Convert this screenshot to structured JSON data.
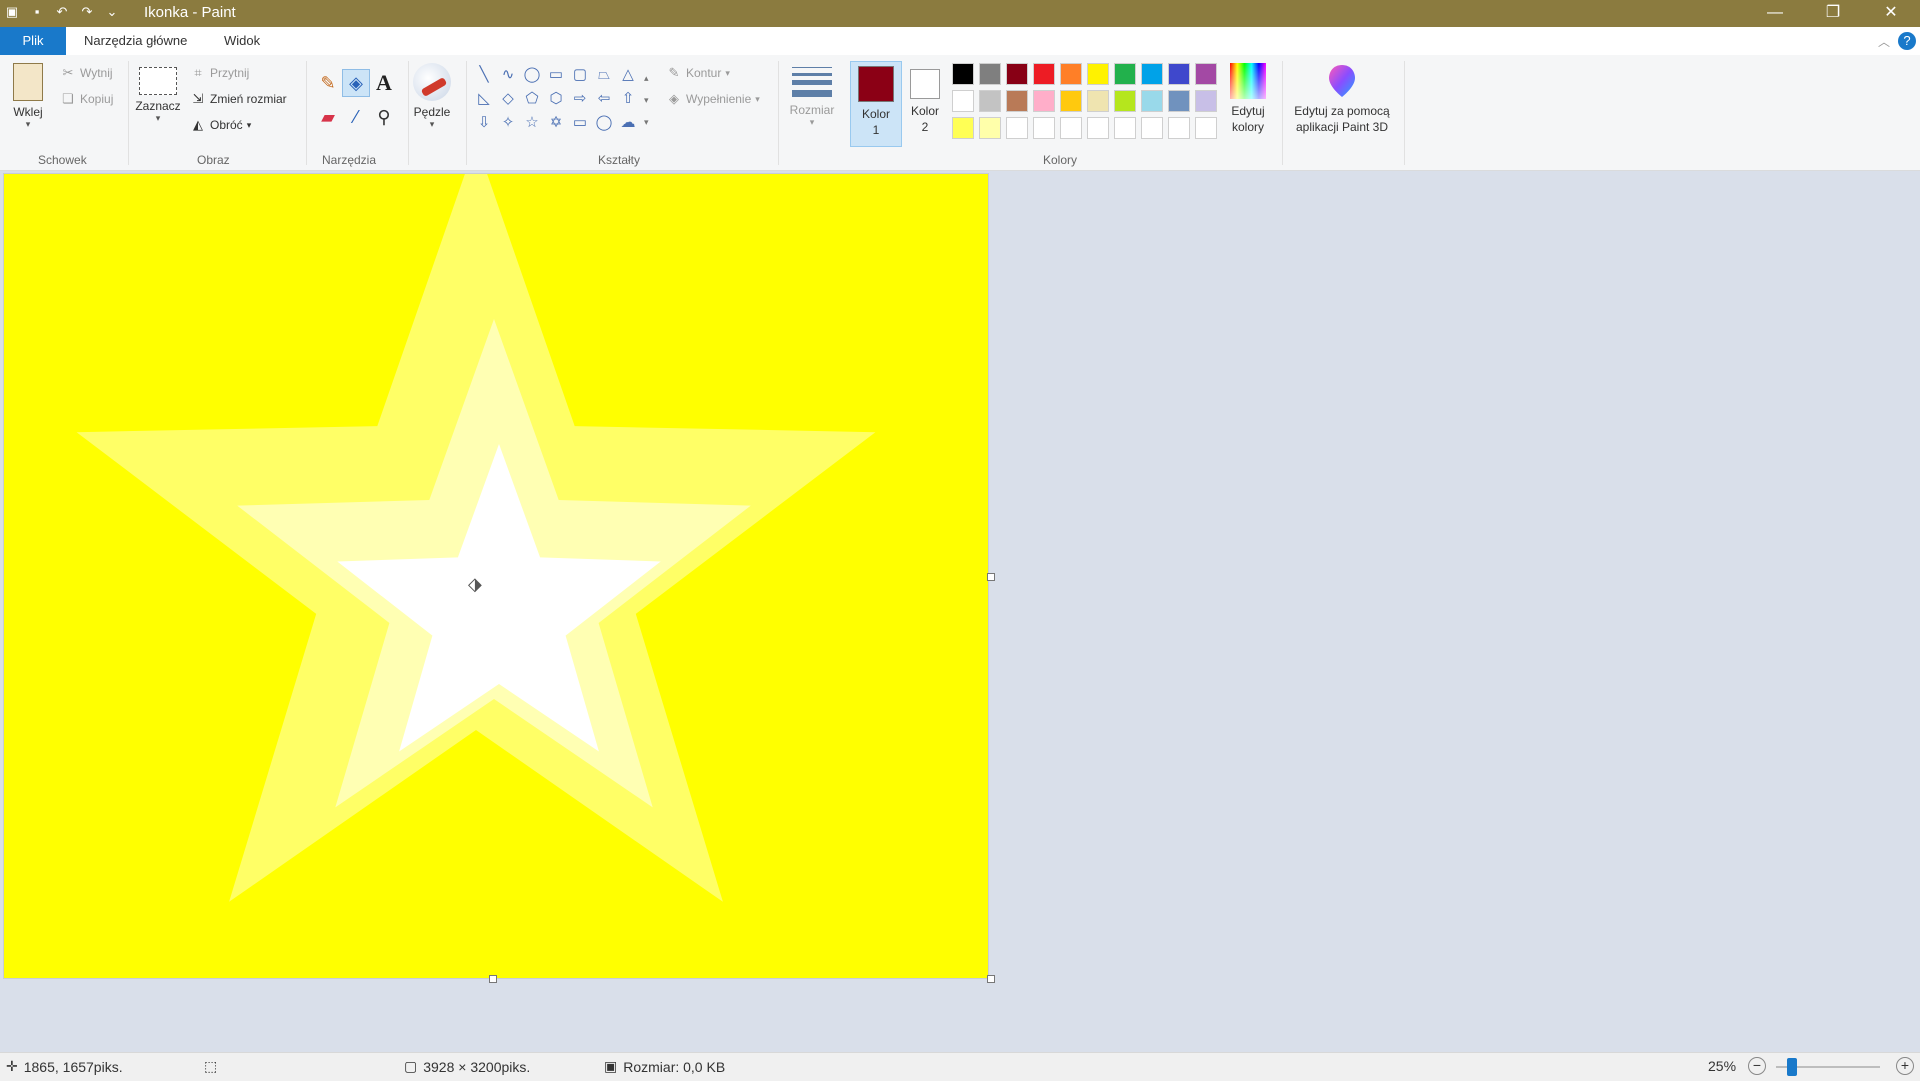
{
  "window": {
    "title": "Ikonka - Paint"
  },
  "tabs": {
    "file": "Plik",
    "home": "Narzędzia główne",
    "view": "Widok"
  },
  "ribbon": {
    "clipboard": {
      "paste": "Wklej",
      "cut": "Wytnij",
      "copy": "Kopiuj",
      "label": "Schowek"
    },
    "image": {
      "select": "Zaznacz",
      "crop": "Przytnij",
      "resize": "Zmień rozmiar",
      "rotate": "Obróć",
      "label": "Obraz"
    },
    "tools": {
      "label": "Narzędzia"
    },
    "brushes": {
      "label": "Pędzle"
    },
    "shapes": {
      "label": "Kształty",
      "outline": "Kontur",
      "fill": "Wypełnienie"
    },
    "size": {
      "label": "Rozmiar"
    },
    "colors": {
      "label": "Kolory",
      "color1": "Kolor\n1",
      "color2": "Kolor\n2",
      "edit": "Edytuj kolory",
      "paint3d": "Edytuj za pomocą aplikacji Paint 3D",
      "color1_value": "#8b0015",
      "color2_value": "#ffffff",
      "palette": [
        "#000000",
        "#7f7f7f",
        "#880015",
        "#ed1c24",
        "#ff7f27",
        "#fff200",
        "#22b14c",
        "#00a2e8",
        "#3f48cc",
        "#a349a4",
        "#ffffff",
        "#c3c3c3",
        "#b97a57",
        "#ffaec9",
        "#ffc90e",
        "#efe4b0",
        "#b5e61d",
        "#99d9ea",
        "#7092be",
        "#c8bfe7",
        "#ffff55",
        "#ffffaa",
        "#ffffff",
        "#ffffff",
        "#ffffff",
        "#ffffff",
        "#ffffff",
        "#ffffff",
        "#ffffff",
        "#ffffff"
      ]
    }
  },
  "canvas": {
    "background": "#ffff00",
    "outer_star": "#ffff66",
    "middle_star": "#ffffb3",
    "inner_star": "#ffffff"
  },
  "status": {
    "cursor": "1865, 1657piks.",
    "dimensions": "3928 × 3200piks.",
    "size": "Rozmiar: 0,0 KB",
    "zoom": "25%"
  }
}
